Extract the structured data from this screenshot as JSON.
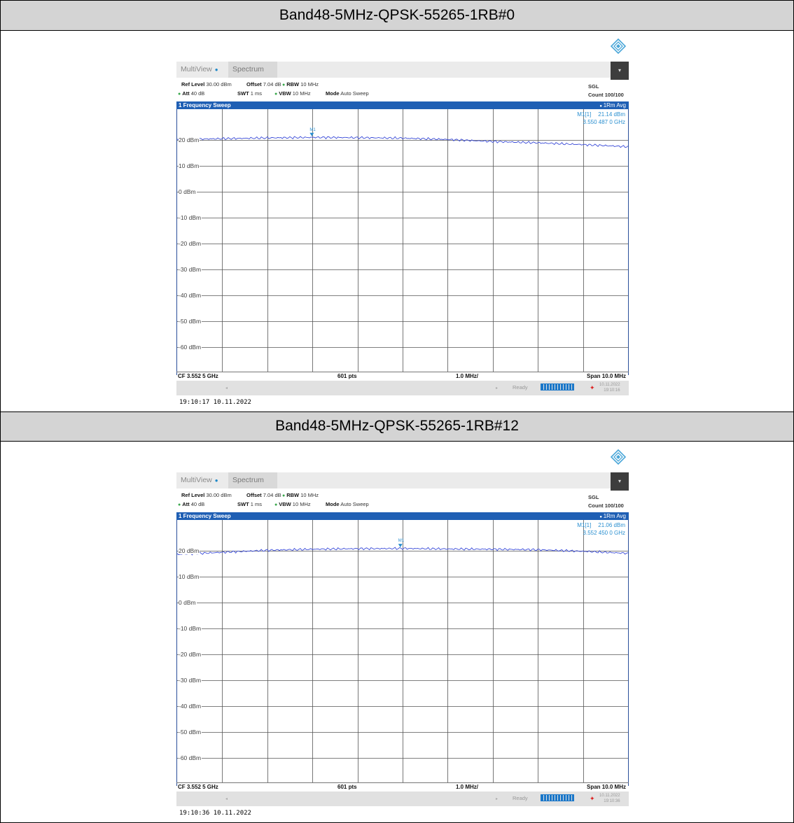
{
  "panels": [
    {
      "title": "Band48-5MHz-QPSK-55265-1RB#0",
      "tabs": [
        "MultiView",
        "Spectrum"
      ],
      "ref_level_label": "Ref Level",
      "ref_level": "30.00 dBm",
      "offset_label": "Offset",
      "offset": "7.04 dB",
      "rbw_label": "RBW",
      "rbw": "10 MHz",
      "att_label": "Att",
      "att": "40 dB",
      "swt_label": "SWT",
      "swt": "1 ms",
      "vbw_label": "VBW",
      "vbw": "10 MHz",
      "mode_label": "Mode",
      "mode": "Auto Sweep",
      "sgl": "SGL",
      "count": "Count 100/100",
      "sweep_title": "1 Frequency Sweep",
      "avg": "1Rm Avg",
      "marker_name": "M1[1]",
      "marker_level": "21.14 dBm",
      "marker_freq": "3.550 487 0 GHz",
      "marker_label": "M1",
      "cf": "CF 3.552 5 GHz",
      "pts": "601 pts",
      "div": "1.0 MHz/",
      "span": "Span 10.0 MHz",
      "status": "Ready",
      "status_date": "10.11.2022",
      "status_time": "19:10:16",
      "timestamp": "19:10:17  10.11.2022",
      "chart_data": {
        "type": "line",
        "y_ticks": [
          "20 dBm",
          "10 dBm",
          "0 dBm",
          "-10 dBm",
          "-20 dBm",
          "-30 dBm",
          "-40 dBm",
          "-50 dBm",
          "-60 dBm"
        ],
        "ylim": [
          -70,
          25
        ],
        "xlim": [
          3.5475,
          3.5575
        ],
        "marker": {
          "x": 3.550487,
          "y": 21.14
        },
        "series": [
          {
            "x": [
              3.5475,
              3.5485,
              3.5495,
              3.5505,
              3.5515,
              3.5525,
              3.5535,
              3.5545,
              3.5555,
              3.5565,
              3.5575
            ],
            "y": [
              20.2,
              20.5,
              20.8,
              21.0,
              20.9,
              20.7,
              20.2,
              19.4,
              18.9,
              18.2,
              17.4
            ]
          }
        ]
      }
    },
    {
      "title": "Band48-5MHz-QPSK-55265-1RB#12",
      "tabs": [
        "MultiView",
        "Spectrum"
      ],
      "ref_level_label": "Ref Level",
      "ref_level": "30.00 dBm",
      "offset_label": "Offset",
      "offset": "7.04 dB",
      "rbw_label": "RBW",
      "rbw": "10 MHz",
      "att_label": "Att",
      "att": "40 dB",
      "swt_label": "SWT",
      "swt": "1 ms",
      "vbw_label": "VBW",
      "vbw": "10 MHz",
      "mode_label": "Mode",
      "mode": "Auto Sweep",
      "sgl": "SGL",
      "count": "Count 100/100",
      "sweep_title": "1 Frequency Sweep",
      "avg": "1Rm Avg",
      "marker_name": "M1[1]",
      "marker_level": "21.06 dBm",
      "marker_freq": "3.552 450 0 GHz",
      "marker_label": "M1",
      "cf": "CF 3.552 5 GHz",
      "pts": "601 pts",
      "div": "1.0 MHz/",
      "span": "Span 10.0 MHz",
      "status": "Ready",
      "status_date": "10.11.2022",
      "status_time": "19:10:36",
      "timestamp": "19:10:36  10.11.2022",
      "chart_data": {
        "type": "line",
        "y_ticks": [
          "20 dBm",
          "10 dBm",
          "0 dBm",
          "-10 dBm",
          "-20 dBm",
          "-30 dBm",
          "-40 dBm",
          "-50 dBm",
          "-60 dBm"
        ],
        "ylim": [
          -70,
          25
        ],
        "xlim": [
          3.5475,
          3.5575
        ],
        "marker": {
          "x": 3.55245,
          "y": 21.06
        },
        "series": [
          {
            "x": [
              3.5475,
              3.5485,
              3.5495,
              3.5505,
              3.5515,
              3.5525,
              3.5535,
              3.5545,
              3.5555,
              3.5565,
              3.5575
            ],
            "y": [
              18.6,
              19.4,
              20.2,
              20.6,
              20.8,
              20.9,
              20.7,
              20.6,
              20.4,
              19.8,
              19.0
            ]
          }
        ]
      }
    }
  ]
}
